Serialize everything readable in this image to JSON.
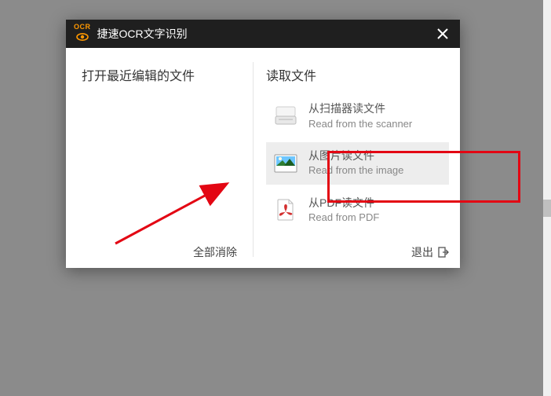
{
  "logo": {
    "ocr": "OCR"
  },
  "titlebar": {
    "title": "捷速OCR文字识别"
  },
  "left": {
    "section_title": "打开最近编辑的文件",
    "clear_all": "全部消除"
  },
  "right": {
    "section_title": "读取文件",
    "options": [
      {
        "cn": "从扫描器读文件",
        "en": "Read from the scanner"
      },
      {
        "cn": "从图片读文件",
        "en": "Read from the image"
      },
      {
        "cn": "从PDF读文件",
        "en": "Read from PDF"
      }
    ],
    "exit": "退出"
  }
}
